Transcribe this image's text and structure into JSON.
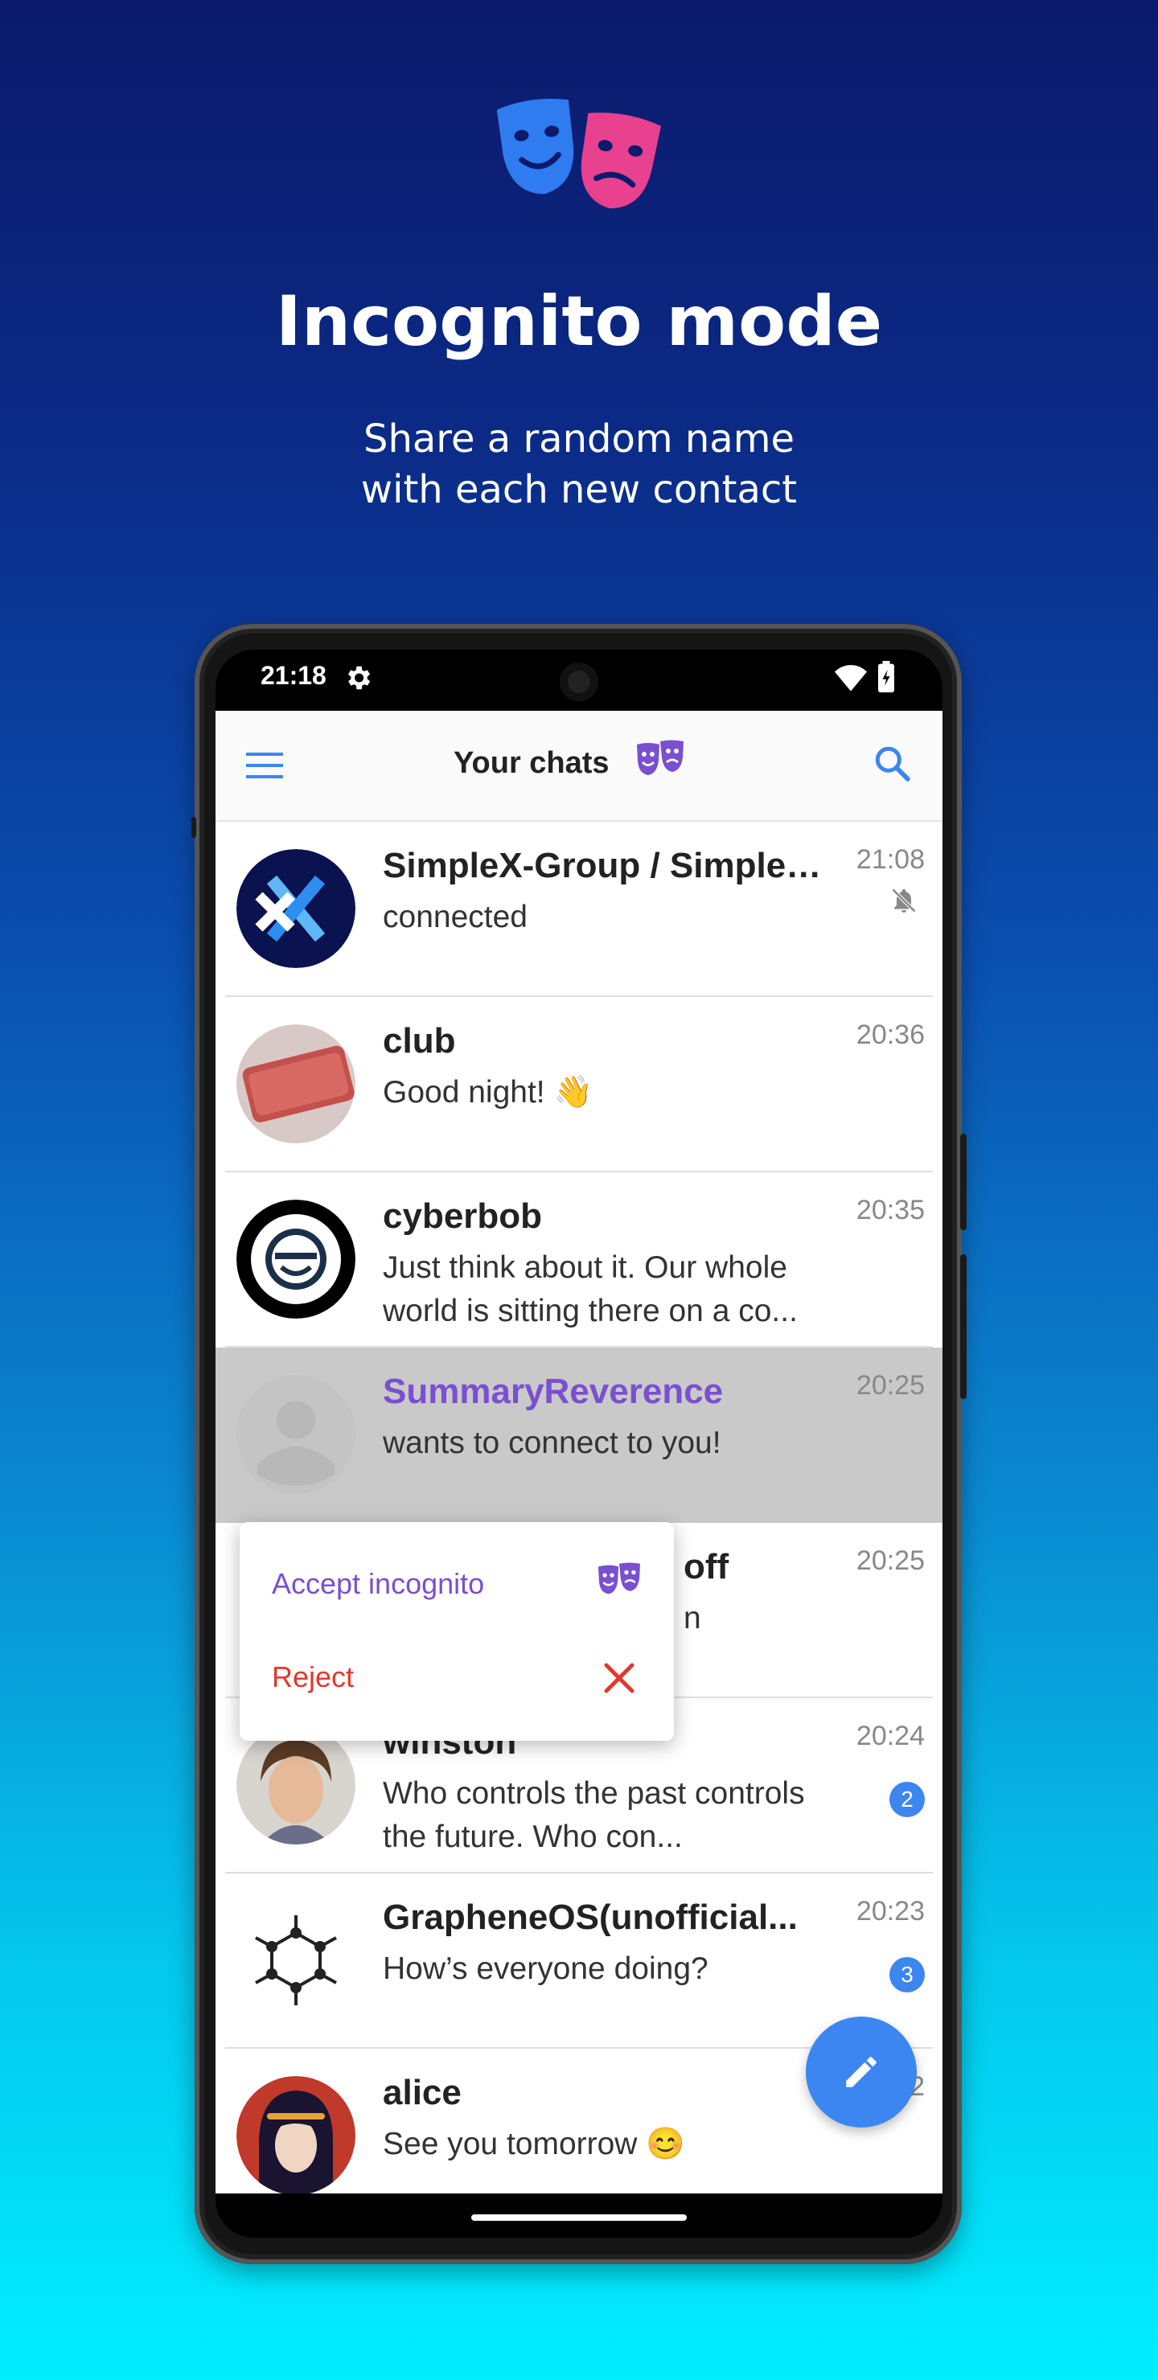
{
  "promo": {
    "headline": "Incognito mode",
    "subline_1": "Share a random name",
    "subline_2": "with each new contact"
  },
  "status_bar": {
    "time": "21:18"
  },
  "app_bar": {
    "title": "Your chats"
  },
  "chats": [
    {
      "name": "SimpleX-Group / SimpleX...",
      "message": "connected",
      "time": "21:08",
      "muted": true
    },
    {
      "name": "club",
      "message": "Good night! 👋",
      "time": "20:36"
    },
    {
      "name": "cyberbob",
      "message": "Just think about it. Our whole world is sitting there on a co...",
      "time": "20:35"
    },
    {
      "name": "SummaryReverence",
      "message": "wants to connect to you!",
      "time": "20:25",
      "incognito_request": true
    },
    {
      "name_tail": "off",
      "message_tail": "n",
      "time": "20:25"
    },
    {
      "name": "winston",
      "message": "Who controls the past controls the future. Who con...",
      "time": "20:24",
      "unread": "2"
    },
    {
      "name": "GrapheneOS(unofficial...",
      "message": "How’s everyone doing?",
      "time": "20:23",
      "unread": "3"
    },
    {
      "name": "alice",
      "message": "See you tomorrow 😊",
      "time_tail": "2"
    }
  ],
  "popup_menu": {
    "accept": "Accept incognito",
    "reject": "Reject"
  },
  "colors": {
    "accent": "#3b86f0",
    "incognito": "#7a4fd0",
    "reject": "#e0392b",
    "mask_blue": "#2f7bf0",
    "mask_pink": "#e8418f"
  }
}
